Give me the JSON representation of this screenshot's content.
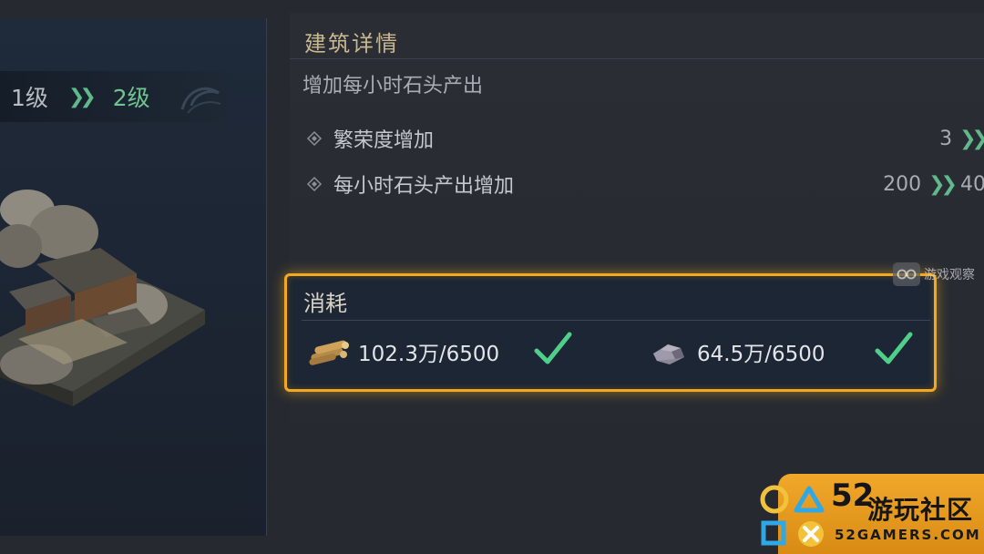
{
  "upgrade": {
    "from_level": "1级",
    "arrow": "»",
    "to_level": "2级"
  },
  "details": {
    "title": "建筑详情",
    "description": "增加每小时石头产出",
    "stats": [
      {
        "label": "繁荣度增加",
        "from": "3",
        "to": ""
      },
      {
        "label": "每小时石头产出增加",
        "from": "200",
        "to": "40"
      }
    ]
  },
  "consume": {
    "title": "消耗",
    "resources": [
      {
        "icon": "wood-icon",
        "amount": "102.3万/6500",
        "sufficient": true
      },
      {
        "icon": "stone-icon",
        "amount": "64.5万/6500",
        "sufficient": true
      }
    ],
    "highlight_color": "#f2a91f",
    "check_color": "#4fd08a"
  },
  "watermark": {
    "text": "游戏观察"
  },
  "logo": {
    "number": "52",
    "name_cn": "游玩社区",
    "name_en": "52GAMERS.COM"
  }
}
